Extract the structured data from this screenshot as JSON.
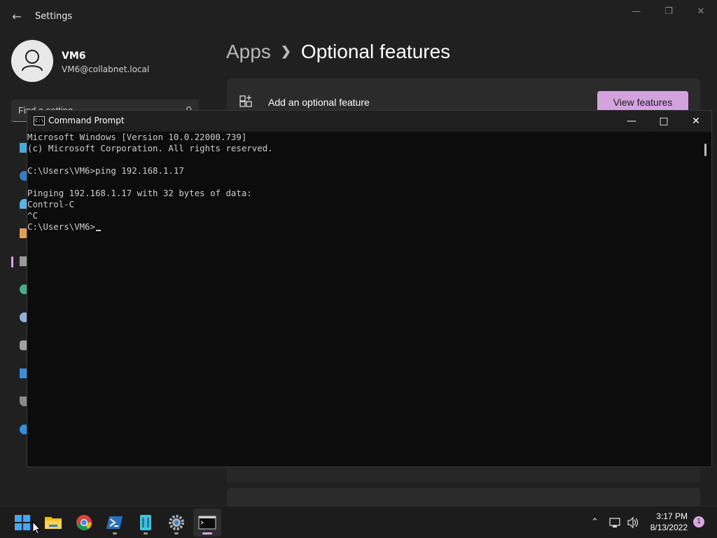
{
  "settings": {
    "title": "Settings",
    "user": {
      "name": "VM6",
      "email": "VM6@collabnet.local"
    },
    "search": {
      "placeholder": "Find a setting"
    },
    "breadcrumb": {
      "parent": "Apps",
      "current": "Optional features"
    },
    "feature_card": {
      "label": "Add an optional feature",
      "button": "View features"
    },
    "nav_icons": [
      "system-icon",
      "bluetooth-icon",
      "network-icon",
      "personalization-icon",
      "apps-icon",
      "accounts-icon",
      "time-language-icon",
      "gaming-icon",
      "accessibility-icon",
      "privacy-icon",
      "windows-update-icon"
    ]
  },
  "cmd": {
    "title": "Command Prompt",
    "lines": [
      "Microsoft Windows [Version 10.0.22000.739]",
      "(c) Microsoft Corporation. All rights reserved.",
      "",
      "C:\\Users\\VM6>ping 192.168.1.17",
      "",
      "Pinging 192.168.1.17 with 32 bytes of data:",
      "Control-C",
      "^C",
      "C:\\Users\\VM6>"
    ]
  },
  "taskbar": {
    "apps": [
      "start-icon",
      "file-explorer-icon",
      "chrome-icon",
      "powershell-icon",
      "azure-data-icon",
      "settings-icon",
      "terminal-icon"
    ],
    "clock": {
      "time": "3:17 PM",
      "date": "8/13/2022"
    },
    "notification_count": "1"
  },
  "colors": {
    "accent": "#d3a3dd",
    "console_bg": "#0c0c0c",
    "console_text": "#cccccc"
  }
}
